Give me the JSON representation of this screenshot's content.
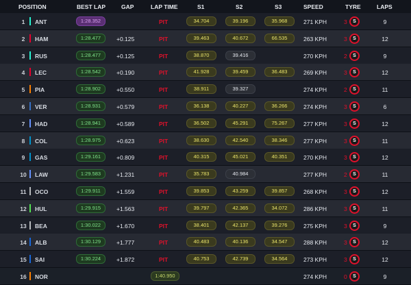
{
  "headers": {
    "position": "POSITION",
    "best_lap": "BEST LAP",
    "gap": "GAP",
    "lap_time": "LAP TIME",
    "s1": "S1",
    "s2": "S2",
    "s3": "S3",
    "speed": "SPEED",
    "tyre": "TYRE",
    "laps": "LAPS"
  },
  "colors": {
    "pit": "#e0112b",
    "purple_sector": "#d9a2f0",
    "green_sector": "#7fe28a",
    "yellow_sector": "#e9e36a"
  },
  "rows": [
    {
      "pos": "1",
      "driver": "ANT",
      "team_color": "#27f4d2",
      "best": "1:28.352",
      "best_purple": true,
      "gap": "",
      "status": "PIT",
      "lap_time": "",
      "s1": "34.704",
      "s2": "39.196",
      "s3": "35.968",
      "s1c": "y",
      "s2c": "y",
      "s3c": "y",
      "speed": "271 KPH",
      "tyre_laps": "3",
      "tyre": "S",
      "laps": "9"
    },
    {
      "pos": "2",
      "driver": "HAM",
      "team_color": "#e8002d",
      "best": "1:28.477",
      "best_purple": false,
      "gap": "+0.125",
      "status": "PIT",
      "lap_time": "",
      "s1": "39.463",
      "s2": "40.672",
      "s3": "66.535",
      "s1c": "y",
      "s2c": "y",
      "s3c": "y",
      "speed": "263 KPH",
      "tyre_laps": "3",
      "tyre": "S",
      "laps": "12"
    },
    {
      "pos": "3",
      "driver": "RUS",
      "team_color": "#27f4d2",
      "best": "1:28.477",
      "best_purple": false,
      "gap": "+0.125",
      "status": "PIT",
      "lap_time": "",
      "s1": "38.870",
      "s2": "39.416",
      "s3": "",
      "s1c": "y",
      "s2c": "w",
      "s3c": "",
      "speed": "270 KPH",
      "tyre_laps": "2",
      "tyre": "S",
      "laps": "9"
    },
    {
      "pos": "4",
      "driver": "LEC",
      "team_color": "#e8002d",
      "best": "1:28.542",
      "best_purple": false,
      "gap": "+0.190",
      "status": "PIT",
      "lap_time": "",
      "s1": "41.928",
      "s2": "39.459",
      "s3": "36.483",
      "s1c": "y",
      "s2c": "y",
      "s3c": "y",
      "speed": "269 KPH",
      "tyre_laps": "3",
      "tyre": "S",
      "laps": "12"
    },
    {
      "pos": "5",
      "driver": "PIA",
      "team_color": "#ff8000",
      "best": "1:28.902",
      "best_purple": false,
      "gap": "+0.550",
      "status": "PIT",
      "lap_time": "",
      "s1": "38.911",
      "s2": "39.327",
      "s3": "",
      "s1c": "y",
      "s2c": "w",
      "s3c": "",
      "speed": "274 KPH",
      "tyre_laps": "2",
      "tyre": "S",
      "laps": "11"
    },
    {
      "pos": "6",
      "driver": "VER",
      "team_color": "#3671c6",
      "best": "1:28.931",
      "best_purple": false,
      "gap": "+0.579",
      "status": "PIT",
      "lap_time": "",
      "s1": "36.138",
      "s2": "40.227",
      "s3": "36.266",
      "s1c": "y",
      "s2c": "y",
      "s3c": "y",
      "speed": "274 KPH",
      "tyre_laps": "3",
      "tyre": "S",
      "laps": "6"
    },
    {
      "pos": "7",
      "driver": "HAD",
      "team_color": "#6692ff",
      "best": "1:28.941",
      "best_purple": false,
      "gap": "+0.589",
      "status": "PIT",
      "lap_time": "",
      "s1": "36.502",
      "s2": "45.291",
      "s3": "75.267",
      "s1c": "y",
      "s2c": "y",
      "s3c": "y",
      "speed": "277 KPH",
      "tyre_laps": "3",
      "tyre": "S",
      "laps": "12"
    },
    {
      "pos": "8",
      "driver": "COL",
      "team_color": "#0093cc",
      "best": "1:28.975",
      "best_purple": false,
      "gap": "+0.623",
      "status": "PIT",
      "lap_time": "",
      "s1": "38.630",
      "s2": "42.540",
      "s3": "38.346",
      "s1c": "y",
      "s2c": "y",
      "s3c": "y",
      "speed": "277 KPH",
      "tyre_laps": "3",
      "tyre": "S",
      "laps": "11"
    },
    {
      "pos": "9",
      "driver": "GAS",
      "team_color": "#0093cc",
      "best": "1:29.161",
      "best_purple": false,
      "gap": "+0.809",
      "status": "PIT",
      "lap_time": "",
      "s1": "40.315",
      "s2": "45.021",
      "s3": "40.351",
      "s1c": "y",
      "s2c": "y",
      "s3c": "y",
      "speed": "270 KPH",
      "tyre_laps": "3",
      "tyre": "S",
      "laps": "12"
    },
    {
      "pos": "10",
      "driver": "LAW",
      "team_color": "#6692ff",
      "best": "1:29.583",
      "best_purple": false,
      "gap": "+1.231",
      "status": "PIT",
      "lap_time": "",
      "s1": "35.783",
      "s2": "40.984",
      "s3": "",
      "s1c": "y",
      "s2c": "w",
      "s3c": "",
      "speed": "277 KPH",
      "tyre_laps": "2",
      "tyre": "S",
      "laps": "11"
    },
    {
      "pos": "11",
      "driver": "OCO",
      "team_color": "#b6babd",
      "best": "1:29.911",
      "best_purple": false,
      "gap": "+1.559",
      "status": "PIT",
      "lap_time": "",
      "s1": "39.853",
      "s2": "43.259",
      "s3": "39.857",
      "s1c": "y",
      "s2c": "y",
      "s3c": "y",
      "speed": "268 KPH",
      "tyre_laps": "3",
      "tyre": "S",
      "laps": "12"
    },
    {
      "pos": "12",
      "driver": "HUL",
      "team_color": "#52e252",
      "best": "1:29.915",
      "best_purple": false,
      "gap": "+1.563",
      "status": "PIT",
      "lap_time": "",
      "s1": "39.797",
      "s2": "42.365",
      "s3": "34.072",
      "s1c": "y",
      "s2c": "y",
      "s3c": "y",
      "speed": "286 KPH",
      "tyre_laps": "3",
      "tyre": "S",
      "laps": "11"
    },
    {
      "pos": "13",
      "driver": "BEA",
      "team_color": "#b6babd",
      "best": "1:30.022",
      "best_purple": false,
      "gap": "+1.670",
      "status": "PIT",
      "lap_time": "",
      "s1": "38.401",
      "s2": "42.137",
      "s3": "39.276",
      "s1c": "y",
      "s2c": "y",
      "s3c": "y",
      "speed": "275 KPH",
      "tyre_laps": "3",
      "tyre": "S",
      "laps": "9"
    },
    {
      "pos": "14",
      "driver": "ALB",
      "team_color": "#1868db",
      "best": "1:30.129",
      "best_purple": false,
      "gap": "+1.777",
      "status": "PIT",
      "lap_time": "",
      "s1": "40.483",
      "s2": "40.136",
      "s3": "34.547",
      "s1c": "y",
      "s2c": "y",
      "s3c": "y",
      "speed": "288 KPH",
      "tyre_laps": "3",
      "tyre": "S",
      "laps": "12"
    },
    {
      "pos": "15",
      "driver": "SAI",
      "team_color": "#1868db",
      "best": "1:30.224",
      "best_purple": false,
      "gap": "+1.872",
      "status": "PIT",
      "lap_time": "",
      "s1": "40.753",
      "s2": "42.739",
      "s3": "34.564",
      "s1c": "y",
      "s2c": "y",
      "s3c": "y",
      "speed": "273 KPH",
      "tyre_laps": "3",
      "tyre": "S",
      "laps": "12"
    },
    {
      "pos": "16",
      "driver": "NOR",
      "team_color": "#ff8000",
      "best": "",
      "best_purple": false,
      "gap": "",
      "status": "",
      "lap_time": "1:40.950",
      "s1": "",
      "s2": "",
      "s3": "",
      "s1c": "",
      "s2c": "",
      "s3c": "",
      "speed": "274 KPH",
      "tyre_laps": "0",
      "tyre": "S",
      "laps": "9"
    }
  ]
}
